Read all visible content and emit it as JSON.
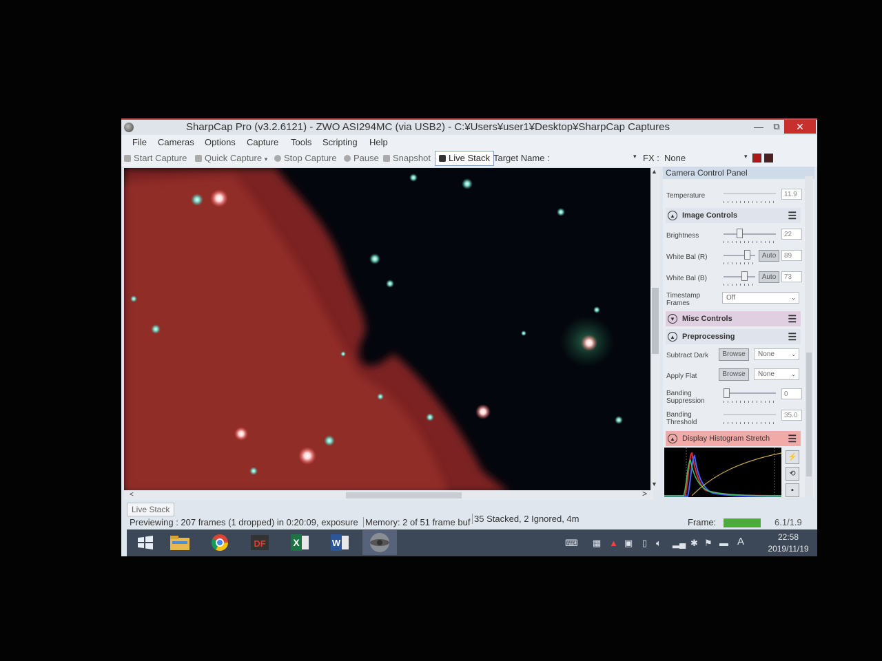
{
  "window": {
    "title": "SharpCap Pro (v3.2.6121) - ZWO ASI294MC (via USB2) - C:¥Users¥user1¥Desktop¥SharpCap Captures",
    "controls": {
      "minimize": "—",
      "maximize": "⧉",
      "close": "✕"
    }
  },
  "menu": [
    "File",
    "Cameras",
    "Options",
    "Capture",
    "Tools",
    "Scripting",
    "Help"
  ],
  "toolbar": {
    "start_capture": "Start Capture",
    "quick_capture": "Quick Capture",
    "stop_capture": "Stop Capture",
    "pause": "Pause",
    "snapshot": "Snapshot",
    "live_stack": "Live Stack",
    "target_name_label": "Target Name :",
    "fx_label": "FX :",
    "fx_value": "None"
  },
  "panel": {
    "header": "Camera Control Panel",
    "temperature": {
      "label": "Temperature",
      "value": "11.9"
    },
    "image_controls": {
      "title": "Image Controls",
      "brightness": {
        "label": "Brightness",
        "value": "22",
        "level": 0.28
      },
      "white_bal_r": {
        "label": "White Bal (R)",
        "auto": "Auto",
        "value": "89",
        "level": 0.82
      },
      "white_bal_b": {
        "label": "White Bal (B)",
        "auto": "Auto",
        "value": "73",
        "level": 0.7
      },
      "timestamp": {
        "label1": "Timestamp",
        "label2": "Frames",
        "value": "Off"
      }
    },
    "misc_controls": {
      "title": "Misc Controls"
    },
    "preprocessing": {
      "title": "Preprocessing",
      "subtract_dark": {
        "label": "Subtract Dark",
        "browse": "Browse",
        "value": "None"
      },
      "apply_flat": {
        "label": "Apply Flat",
        "browse": "Browse",
        "value": "None"
      },
      "banding_suppression": {
        "label1": "Banding",
        "label2": "Suppression",
        "value": "0",
        "level": 0.0
      },
      "banding_threshold": {
        "label1": "Banding",
        "label2": "Threshold",
        "value": "35.0",
        "level": 0.7
      }
    },
    "histogram": {
      "title": "Display Histogram Stretch"
    }
  },
  "bottom": {
    "tab": "Live Stack",
    "status_preview": "Previewing : 207 frames (1 dropped) in 0:20:09, exposure",
    "status_memory": "Memory: 2 of 51 frame buf",
    "status_stack": "35 Stacked, 2 Ignored, 4m",
    "frame_label": "Frame:",
    "frame_ratio": "6.1/1.9"
  },
  "taskbar": {
    "apps": [
      "windows-start",
      "file-explorer",
      "chrome",
      "pdf-app",
      "excel",
      "word",
      "sharpcap"
    ],
    "excel_letter": "X",
    "word_letter": "W",
    "df_text": "DF",
    "ime": "A",
    "time": "22:58",
    "date": "2019/11/19"
  },
  "colors": {
    "close": "#c7302c",
    "nebula": "#a8332b",
    "histo_red": "#e03030",
    "histo_blue": "#4466ff",
    "frame_bar": "#4faa3e"
  }
}
